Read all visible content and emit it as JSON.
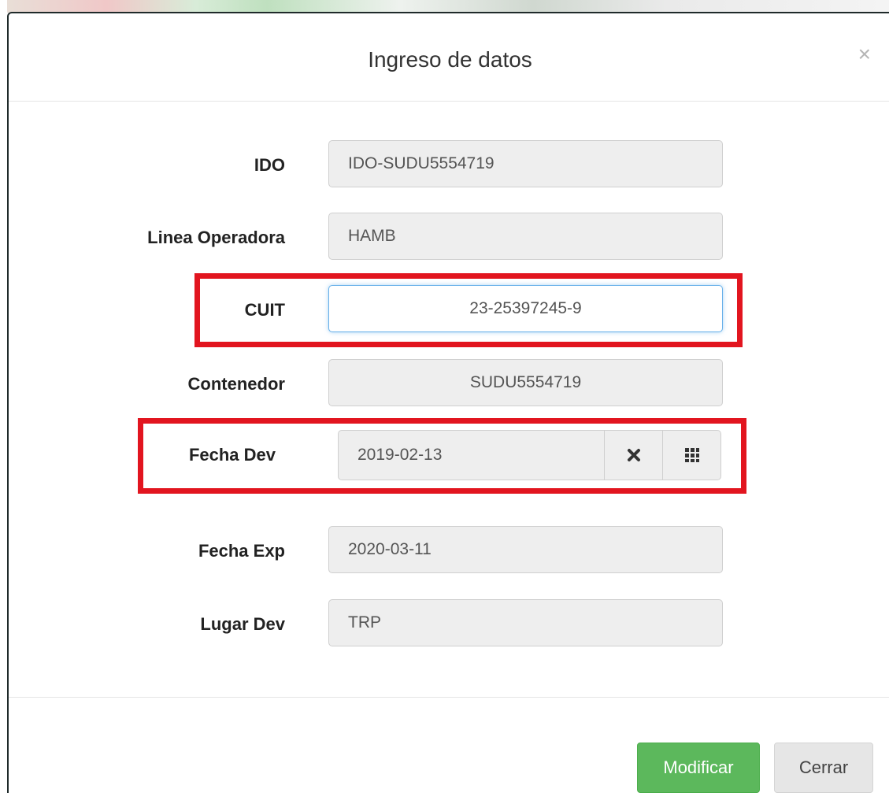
{
  "modal": {
    "title": "Ingreso de datos",
    "close_symbol": "×"
  },
  "fields": {
    "ido": {
      "label": "IDO",
      "value": "IDO-SUDU5554719"
    },
    "linea": {
      "label": "Linea Operadora",
      "value": "HAMB"
    },
    "cuit": {
      "label": "CUIT",
      "value": "23-25397245-9"
    },
    "contenedor": {
      "label": "Contenedor",
      "value": "SUDU5554719"
    },
    "fecha_dev": {
      "label": "Fecha Dev",
      "value": "2019-02-13",
      "clear_icon": "times-icon",
      "calendar_icon": "calendar-grid-icon"
    },
    "fecha_exp": {
      "label": "Fecha Exp",
      "value": "2020-03-11"
    },
    "lugar_dev": {
      "label": "Lugar Dev",
      "value": "TRP"
    }
  },
  "footer": {
    "modify_label": "Modificar",
    "close_label": "Cerrar"
  },
  "colors": {
    "highlight": "#e2151f",
    "success": "#5cb85c",
    "focus": "#66afe9"
  }
}
